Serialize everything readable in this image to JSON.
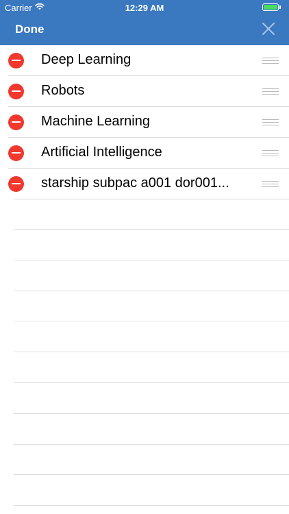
{
  "status_bar": {
    "carrier": "Carrier",
    "wifi_icon": "wifi-icon",
    "time": "12:29 AM",
    "battery_icon": "battery-icon",
    "battery_level": 1.0
  },
  "nav": {
    "done_label": "Done",
    "close_icon": "close-icon",
    "background_color": "#3a78c0"
  },
  "list": {
    "items": [
      {
        "label": "Deep Learning"
      },
      {
        "label": "Robots"
      },
      {
        "label": "Machine Learning"
      },
      {
        "label": "Artificial Intelligence"
      },
      {
        "label": "starship subpac a001 dor001..."
      }
    ],
    "delete_icon": "minus-circle-icon",
    "delete_color": "#f0382f",
    "reorder_icon": "reorder-grip-icon"
  }
}
